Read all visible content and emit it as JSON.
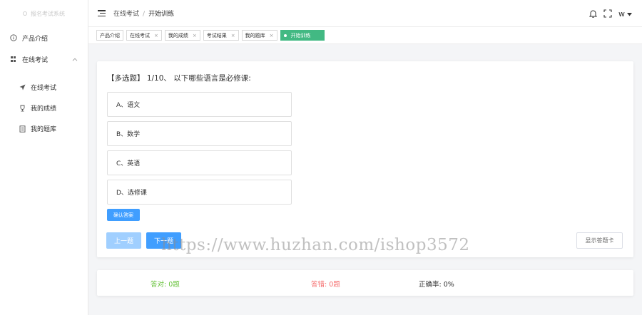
{
  "sidebar": {
    "logo_text": "报名考试系统",
    "items": [
      {
        "label": "产品介绍"
      },
      {
        "label": "在线考试"
      }
    ],
    "submenu": [
      {
        "label": "在线考试"
      },
      {
        "label": "我的成绩"
      },
      {
        "label": "我的题库"
      }
    ]
  },
  "header": {
    "breadcrumb": [
      "在线考试",
      "开始训练"
    ],
    "breadcrumb_sep": "/",
    "user": "w"
  },
  "tags": [
    {
      "label": "产品介绍"
    },
    {
      "label": "在线考试"
    },
    {
      "label": "我的成绩"
    },
    {
      "label": "考试结果"
    },
    {
      "label": "我的题库"
    },
    {
      "label": "开始训练"
    }
  ],
  "question": {
    "title": "【多选题】 1/10、 以下哪些语言是必修课:",
    "options": [
      {
        "label": "A、语文"
      },
      {
        "label": "B、数学"
      },
      {
        "label": "C、英语"
      },
      {
        "label": "D、选修课"
      }
    ],
    "confirm_label": "确认答案",
    "prev_label": "上一题",
    "next_label": "下一题",
    "sheet_label": "显示答题卡"
  },
  "stats": {
    "correct": "答对: 0题",
    "wrong": "答错: 0题",
    "rate": "正确率: 0%"
  },
  "colors": {
    "accent": "#409eff",
    "active_tag": "#42b983",
    "correct": "#67c23a",
    "wrong": "#f56c6c"
  },
  "watermark": "https://www.huzhan.com/ishop3572"
}
